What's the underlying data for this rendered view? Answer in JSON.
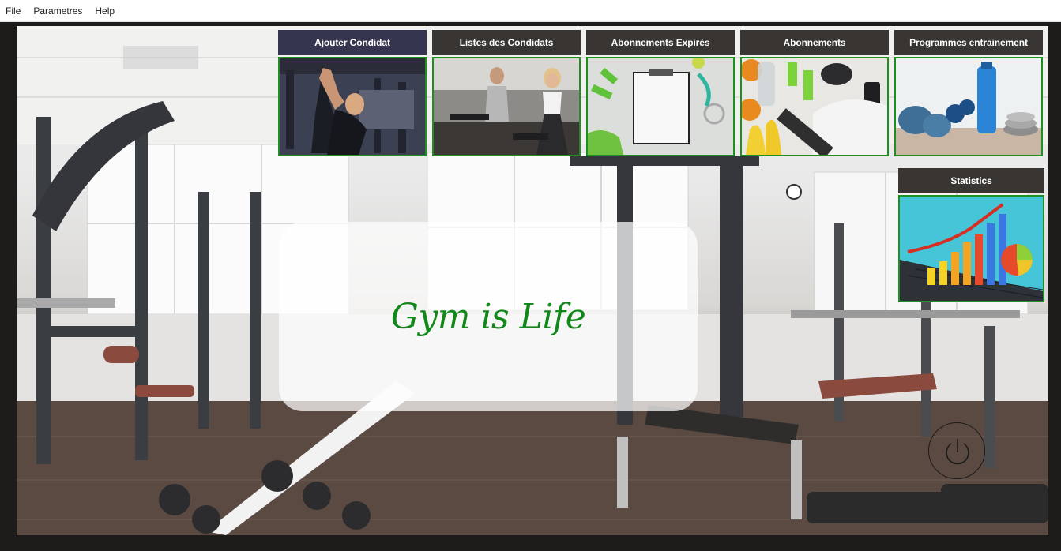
{
  "menu": {
    "items": [
      {
        "label": "File"
      },
      {
        "label": "Parametres"
      },
      {
        "label": "Help"
      }
    ]
  },
  "tiles": [
    {
      "label": "Ajouter Condidat",
      "icon": "man-training-image",
      "active": true
    },
    {
      "label": "Listes des Condidats",
      "icon": "couple-cardio-image",
      "active": false
    },
    {
      "label": "Abonnements Expirés",
      "icon": "dumbbells-clipboard-image",
      "active": false
    },
    {
      "label": "Abonnements",
      "icon": "fruit-and-dumbbells-image",
      "active": false
    },
    {
      "label": "Programmes entrainement",
      "icon": "bottle-towel-weights-image",
      "active": false
    },
    {
      "label": "Statistics",
      "icon": "bar-chart-image",
      "active": false
    }
  ],
  "motto": {
    "text": "Gym is Life"
  },
  "power": {
    "icon": "power-icon"
  },
  "colors": {
    "tile_header": "#383533",
    "tile_header_active": "#36354f",
    "tile_border": "#1f8f24",
    "motto": "#12871a"
  }
}
